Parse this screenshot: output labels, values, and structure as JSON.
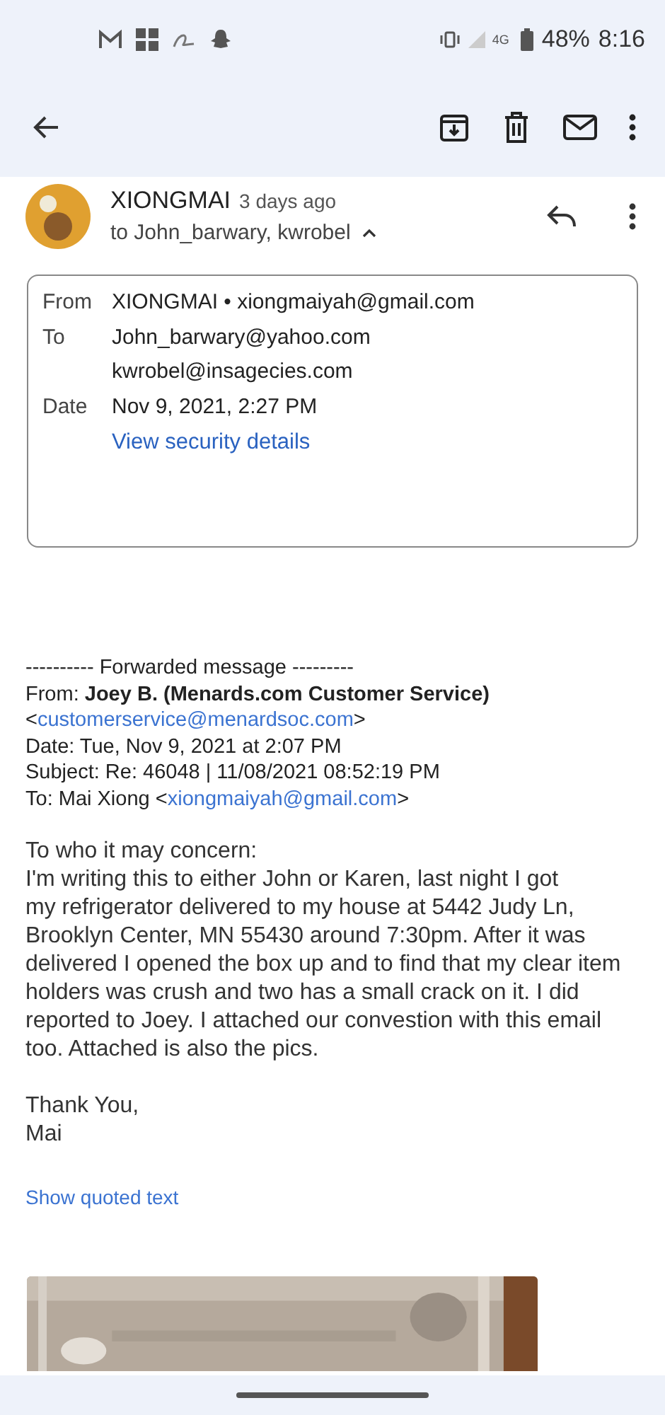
{
  "status_bar": {
    "network": "4G",
    "battery": "48%",
    "time": "8:16"
  },
  "message": {
    "sender": "XIONGMAI",
    "time_ago": "3 days ago",
    "recipients_summary": "to John_barwary, kwrobel",
    "details_expanded": true,
    "details": [
      {
        "label": "From",
        "values": [
          "XIONGMAI • xiongmaiyah@gmail.com"
        ]
      },
      {
        "label": "To",
        "values": [
          "John_barwary@yahoo.com",
          "kwrobel@insagecies.com"
        ]
      },
      {
        "label": "Date",
        "values": [
          "Nov 9, 2021, 2:27 PM"
        ]
      }
    ],
    "security_link": "View security details",
    "forward_header": [
      "---------- Forwarded message ---------",
      "From: **Joey B. (Menards.com Customer Service)**",
      {
        "before": "<",
        "link": "customerservice@menardsoc.com",
        "after": ">"
      },
      "Date: Tue, Nov 9, 2021 at 2:07 PM",
      "Subject: Re: 46048 | 11/08/2021 08:52:19 PM",
      {
        "before": "To: Mai Xiong <",
        "link": "xiongmaiyah@gmail.com",
        "after": ">"
      }
    ],
    "body": [
      "To who it may concern:",
      "I'm writing this to either John or Karen, last night I got",
      "my refrigerator delivered to my house at 5442 Judy Ln, Brooklyn Center, MN 55430 around 7:30pm. After it was delivered I opened the box up and to find that my clear item holders was crush and two has a small crack on it. I did reported to Joey. I attached our convestion with this email too. Attached is also the pics."
    ],
    "signoff": [
      "Thank You,",
      "Mai"
    ],
    "show_quoted": "Show quoted text",
    "attachment": {
      "kind": "picture"
    }
  }
}
